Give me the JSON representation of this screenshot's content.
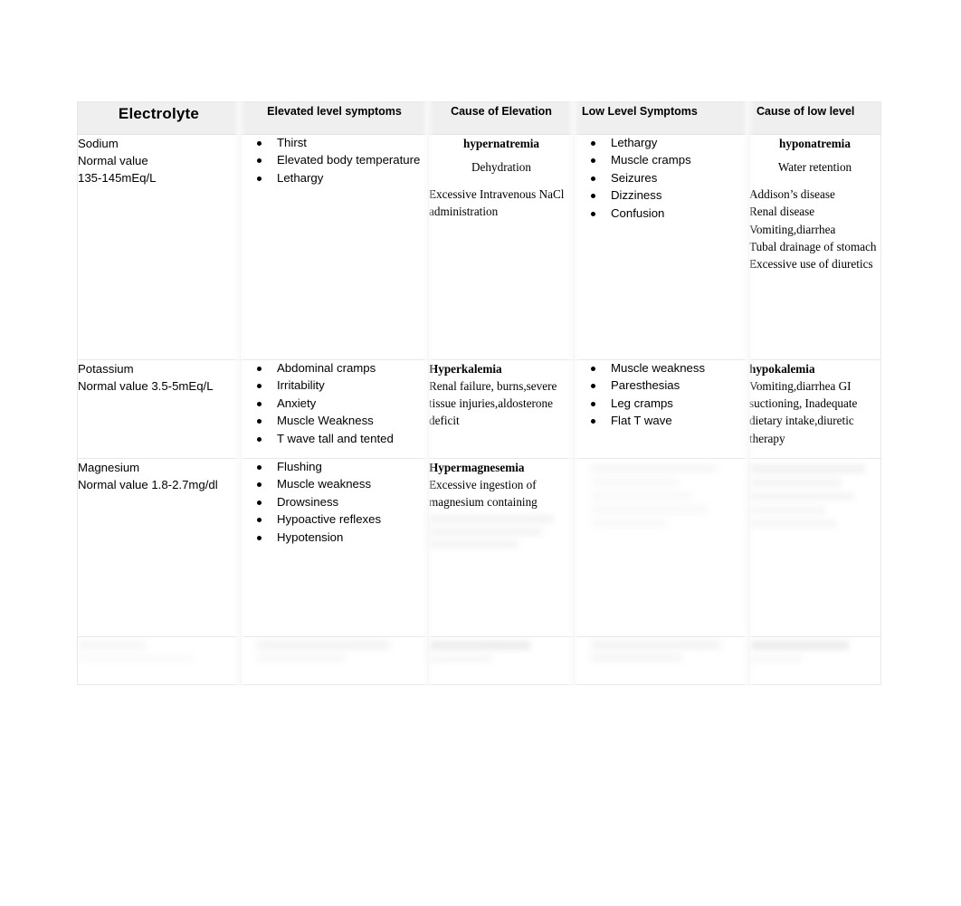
{
  "table": {
    "headers": [
      "Electrolyte",
      "Elevated level symptoms",
      "Cause of Elevation",
      "Low Level Symptoms",
      "Cause of low level"
    ],
    "rows": [
      {
        "electrolyte": {
          "name": "Sodium",
          "normal_label": "Normal value",
          "normal_value": "135-145mEq/L"
        },
        "elevated_symptoms": [
          "Thirst",
          "Elevated body temperature",
          "Lethargy"
        ],
        "cause_of_elevation": {
          "condition": "hypernatremia",
          "centered_causes": [
            "Dehydration"
          ],
          "causes": [
            "Excessive Intravenous NaCl administration"
          ]
        },
        "low_symptoms": [
          "Lethargy",
          "Muscle cramps",
          "Seizures",
          "Dizziness",
          "Confusion"
        ],
        "cause_of_low": {
          "condition": "hyponatremia",
          "centered_causes": [
            "Water retention"
          ],
          "causes": [
            "Addison’s disease",
            "Renal disease",
            "Vomiting,diarrhea",
            "Tubal drainage of stomach",
            "Excessive use of diuretics"
          ]
        }
      },
      {
        "electrolyte": {
          "name": "Potassium",
          "normal_label": "Normal value 3.5-5mEq/L",
          "normal_value": ""
        },
        "elevated_symptoms": [
          "Abdominal cramps",
          "Irritability",
          "Anxiety",
          "Muscle Weakness",
          "T wave tall and tented"
        ],
        "cause_of_elevation": {
          "condition": "Hyperkalemia",
          "centered_causes": [],
          "causes": [
            "Renal failure, burns,severe tissue injuries,aldosterone deficit"
          ]
        },
        "low_symptoms": [
          "Muscle weakness",
          "Paresthesias",
          "Leg cramps",
          "Flat T wave"
        ],
        "cause_of_low": {
          "condition": "hypokalemia",
          "centered_causes": [],
          "causes": [
            "Vomiting,diarrhea GI suctioning, Inadequate dietary intake,diuretic therapy"
          ]
        }
      },
      {
        "electrolyte": {
          "name": "Magnesium",
          "normal_label": "Normal value 1.8-2.7mg/dl",
          "normal_value": ""
        },
        "elevated_symptoms": [
          "Flushing",
          "Muscle weakness",
          "Drowsiness",
          "Hypoactive reflexes",
          "Hypotension"
        ],
        "cause_of_elevation": {
          "condition": "Hypermagnesemia",
          "centered_causes": [],
          "causes": [
            "Excessive ingestion of magnesium containing"
          ]
        },
        "low_symptoms": [],
        "cause_of_low": {
          "condition": "",
          "centered_causes": [],
          "causes": []
        }
      },
      {
        "electrolyte": {
          "name": "",
          "normal_label": "",
          "normal_value": ""
        },
        "elevated_symptoms": [],
        "cause_of_elevation": {
          "condition": "",
          "centered_causes": [],
          "causes": []
        },
        "low_symptoms": [],
        "cause_of_low": {
          "condition": "",
          "centered_causes": [],
          "causes": []
        }
      }
    ]
  }
}
